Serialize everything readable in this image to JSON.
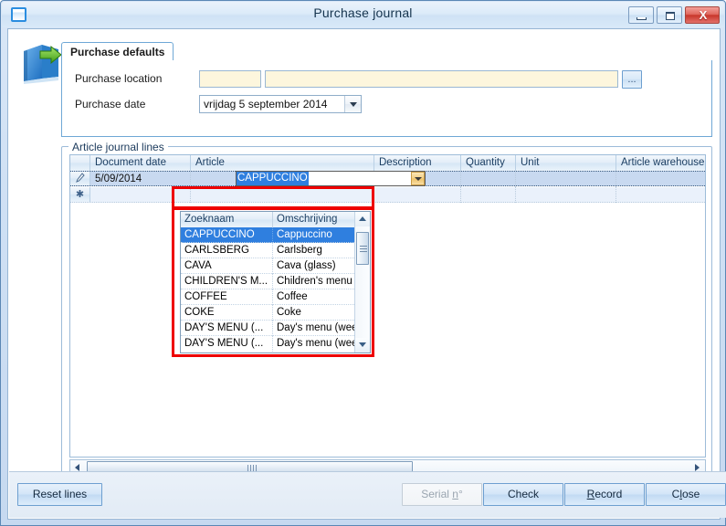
{
  "window": {
    "title": "Purchase journal",
    "icon": "window-icon",
    "caption_buttons": {
      "minimize": "minimize-icon",
      "maximize": "maximize-icon",
      "close": "X"
    }
  },
  "form": {
    "app_icon": "purchase-book-icon",
    "tab": {
      "label": "Purchase defaults"
    },
    "fields": {
      "purchase_location_label": "Purchase location",
      "purchase_location_code": "",
      "purchase_location_name": "",
      "ellipsis_button": "...",
      "purchase_date_label": "Purchase date",
      "purchase_date_value": "vrijdag 5 september 2014"
    }
  },
  "group": {
    "title": "Article journal lines",
    "grid": {
      "columns": [
        "Document date",
        "Article",
        "Description",
        "Quantity",
        "Unit",
        "Article warehouse"
      ],
      "rows": [
        {
          "row_indicator": "pencil-icon",
          "document_date": "5/09/2014",
          "article": "CAPPUCCINO",
          "description": "",
          "quantity": "",
          "unit": "",
          "article_warehouse": ""
        },
        {
          "row_indicator": "asterisk-new-row-icon",
          "document_date": "",
          "article": "",
          "description": "",
          "quantity": "",
          "unit": "",
          "article_warehouse": ""
        }
      ],
      "editor_value": "CAPPUCCINO"
    },
    "dropdown": {
      "columns": [
        "Zoeknaam",
        "Omschrijving"
      ],
      "items": [
        {
          "zoeknaam": "CAPPUCCINO",
          "omschrijving": "Cappuccino",
          "selected": true
        },
        {
          "zoeknaam": "CARLSBERG",
          "omschrijving": "Carlsberg",
          "selected": false
        },
        {
          "zoeknaam": "CAVA",
          "omschrijving": "Cava (glass)",
          "selected": false
        },
        {
          "zoeknaam": "CHILDREN'S M...",
          "omschrijving": "Children's menu",
          "selected": false
        },
        {
          "zoeknaam": "COFFEE",
          "omschrijving": "Coffee",
          "selected": false
        },
        {
          "zoeknaam": "COKE",
          "omschrijving": "Coke",
          "selected": false
        },
        {
          "zoeknaam": "DAY'S MENU (...",
          "omschrijving": "Day's menu (week)",
          "selected": false
        },
        {
          "zoeknaam": "DAY'S MENU (...",
          "omschrijving": "Day's menu (wee...",
          "selected": false
        }
      ]
    }
  },
  "buttons": {
    "reset_lines": "Reset lines",
    "serial_no_pre": "Serial ",
    "serial_no_mn": "n",
    "serial_no_post": "°",
    "check": "Check",
    "record_mn": "R",
    "record_post": "ecord",
    "close_pre": "C",
    "close_mn": "l",
    "close_post": "ose"
  },
  "colors": {
    "accent_blue": "#2f7fdf",
    "highlight_red": "#ee0000",
    "field_yellow": "#fdf6dd",
    "selected_row": "#c8d9f0"
  }
}
